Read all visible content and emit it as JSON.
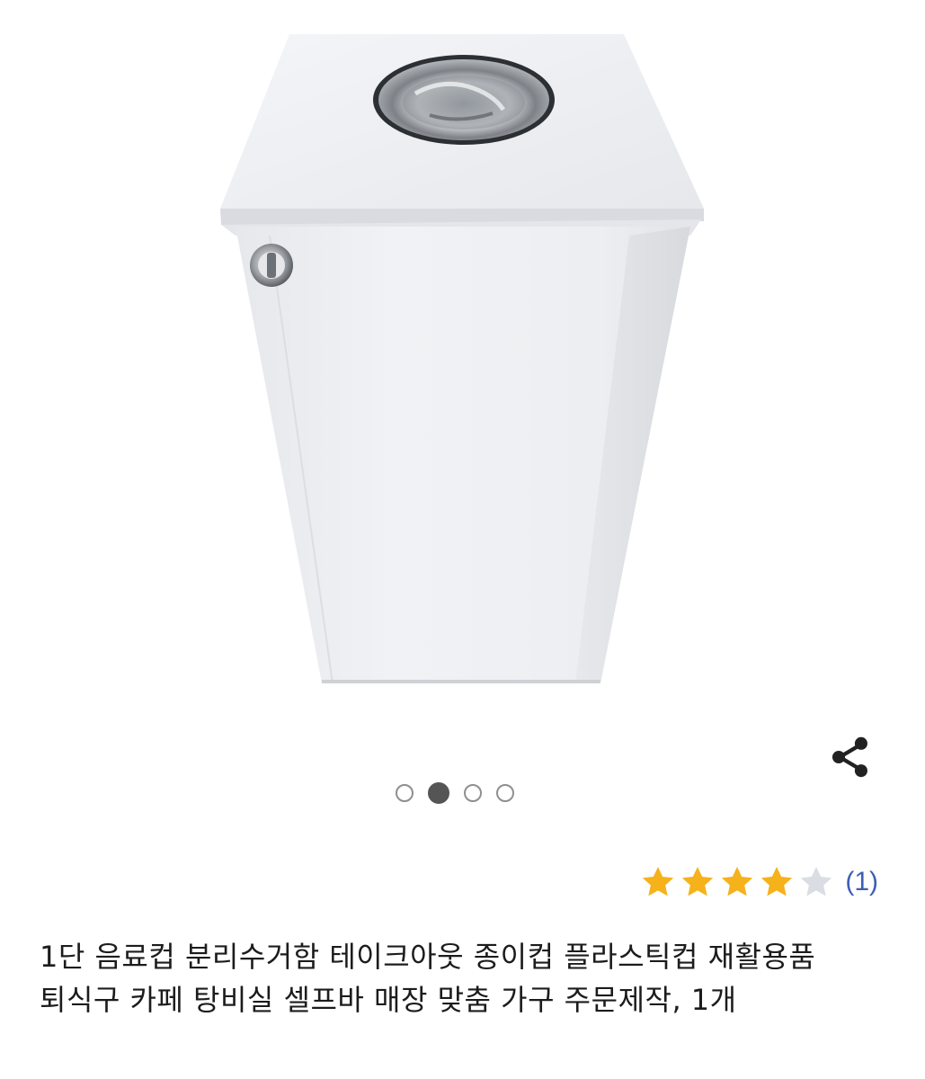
{
  "product": {
    "title": "1단 음료컵 분리수거함 테이크아웃 종이컵 플라스틱컵 재활용품 퇴식구 카페 탕비실 셀프바 매장 맞춤 가구 주문제작, 1개",
    "image_alt": "white cup recycling cabinet with stainless steel top opening"
  },
  "carousel": {
    "total": 4,
    "active_index": 1
  },
  "rating": {
    "value": 4,
    "max": 5,
    "review_count_label": "(1)"
  },
  "icons": {
    "share": "share-icon",
    "star_filled": "star-filled-icon",
    "star_empty": "star-empty-icon"
  },
  "colors": {
    "star_filled": "#f5b21b",
    "star_empty": "#dadde3",
    "review_count": "#3f5fb4",
    "dot_active": "#555555",
    "dot_inactive_border": "#8f8f8f"
  }
}
